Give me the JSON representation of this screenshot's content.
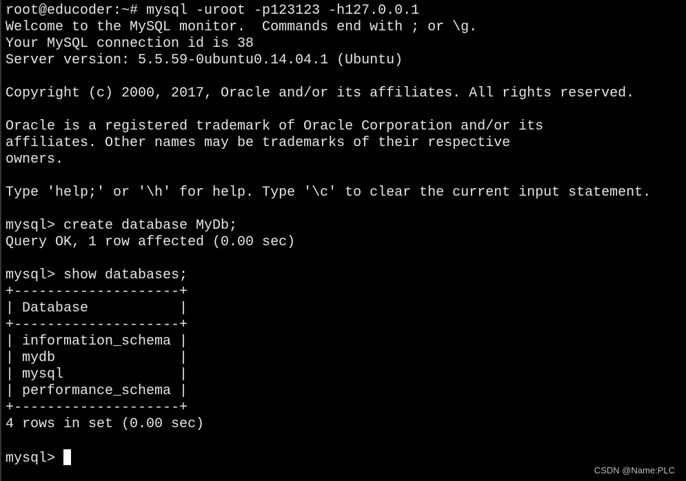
{
  "terminal": {
    "lines": [
      "root@educoder:~# mysql -uroot -p123123 -h127.0.0.1",
      "Welcome to the MySQL monitor.  Commands end with ; or \\g.",
      "Your MySQL connection id is 38",
      "Server version: 5.5.59-0ubuntu0.14.04.1 (Ubuntu)",
      "",
      "Copyright (c) 2000, 2017, Oracle and/or its affiliates. All rights reserved.",
      "",
      "Oracle is a registered trademark of Oracle Corporation and/or its",
      "affiliates. Other names may be trademarks of their respective",
      "owners.",
      "",
      "Type 'help;' or '\\h' for help. Type '\\c' to clear the current input statement.",
      "",
      "mysql> create database MyDb;",
      "Query OK, 1 row affected (0.00 sec)",
      "",
      "mysql> show databases;",
      "+--------------------+",
      "| Database           |",
      "+--------------------+",
      "| information_schema |",
      "| mydb               |",
      "| mysql              |",
      "| performance_schema |",
      "+--------------------+",
      "4 rows in set (0.00 sec)",
      ""
    ],
    "prompt": "mysql> "
  },
  "watermark": "CSDN @Name:PLC"
}
